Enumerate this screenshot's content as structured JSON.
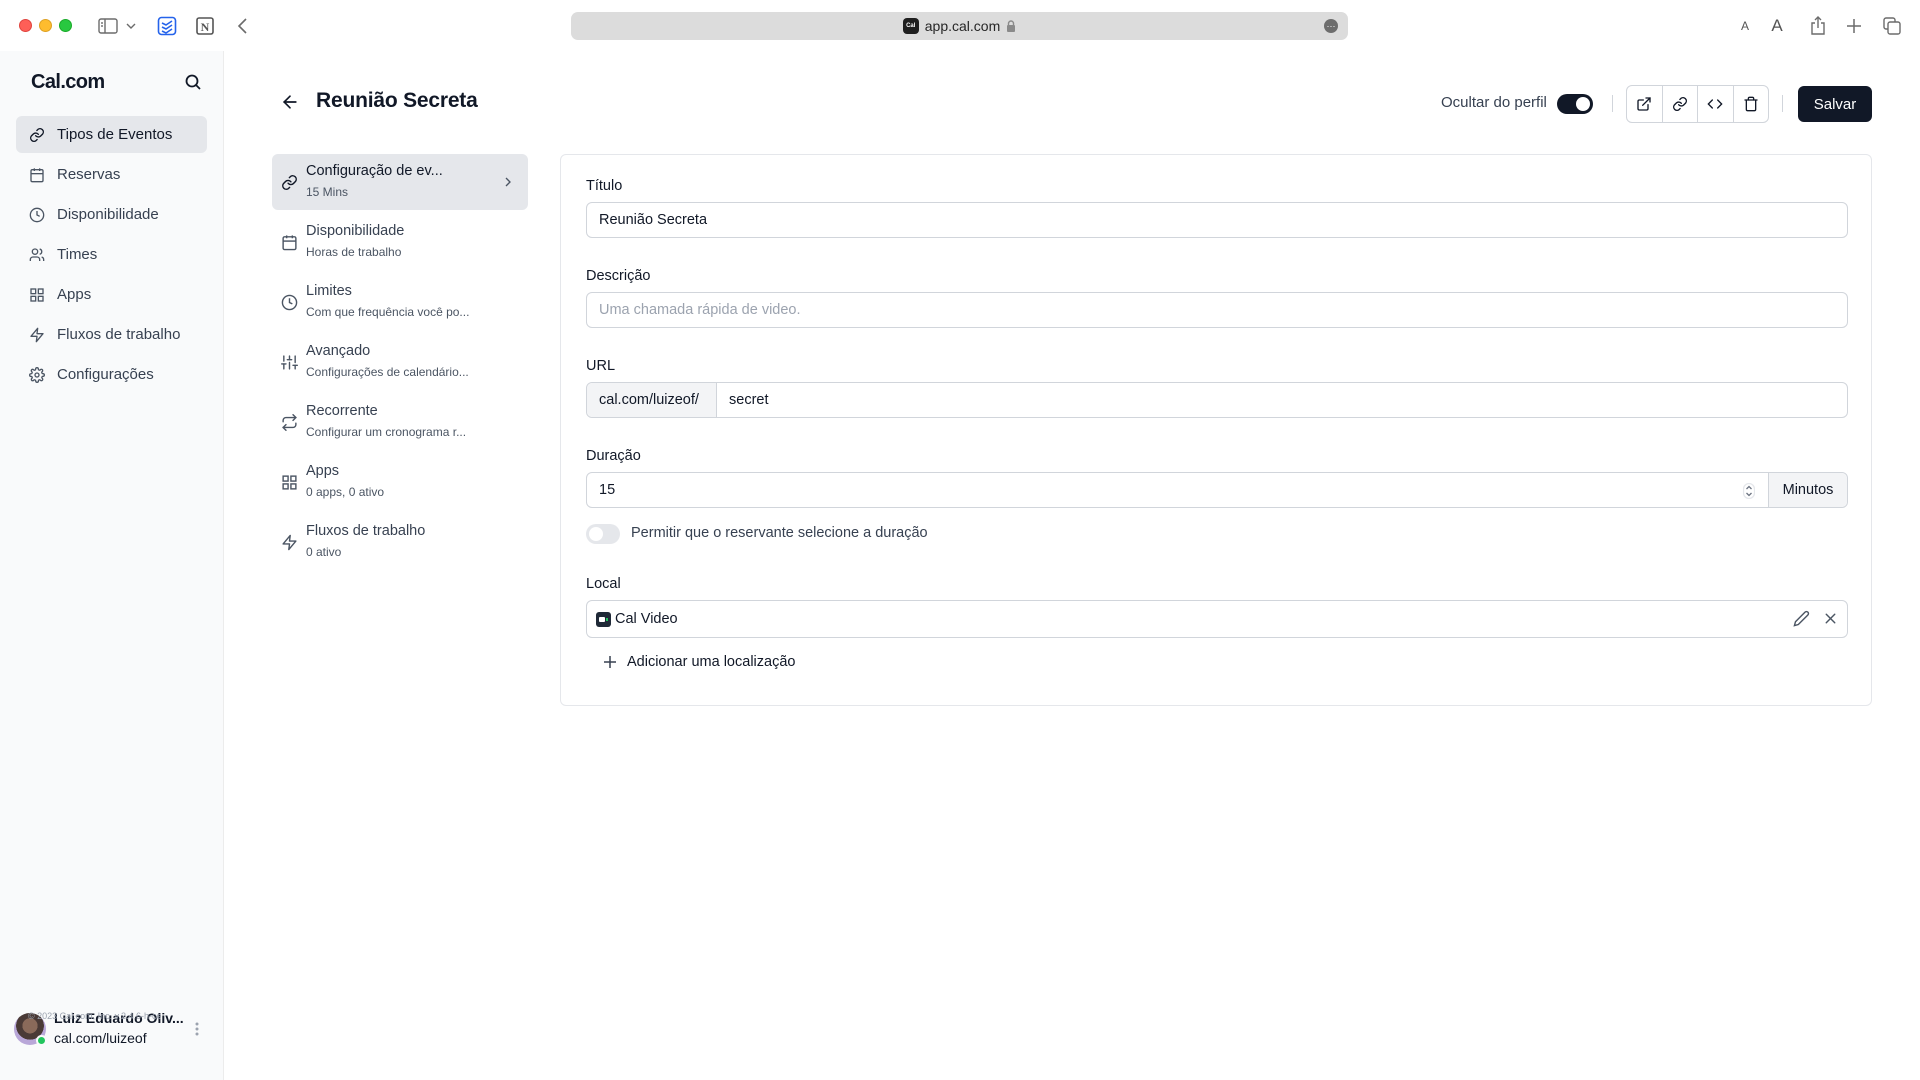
{
  "browser": {
    "url": "app.cal.com",
    "favicon_text": "Cal",
    "text_size_small": "A",
    "text_size_large": "A"
  },
  "sidebar": {
    "brand": "Cal.com",
    "items": [
      {
        "label": "Tipos de Eventos",
        "icon": "link-icon",
        "active": true
      },
      {
        "label": "Reservas",
        "icon": "calendar-icon",
        "active": false
      },
      {
        "label": "Disponibilidade",
        "icon": "clock-icon",
        "active": false
      },
      {
        "label": "Times",
        "icon": "users-icon",
        "active": false
      },
      {
        "label": "Apps",
        "icon": "grid-icon",
        "active": false
      },
      {
        "label": "Fluxos de trabalho",
        "icon": "zap-icon",
        "active": false
      },
      {
        "label": "Configurações",
        "icon": "gear-icon",
        "active": false
      }
    ],
    "user": {
      "name": "Luiz Eduardo Oliv...",
      "handle": "cal.com/luizeof",
      "status": "online"
    },
    "copyright": "© 2023 Cal.com, Inc. v.2.4.6-h-ce"
  },
  "header": {
    "title": "Reunião Secreta",
    "hide_from_profile_label": "Ocultar do perfil",
    "hide_from_profile_on": true,
    "save_label": "Salvar"
  },
  "tabs": [
    {
      "title": "Configuração de ev...",
      "subtitle": "15 Mins",
      "icon": "link-icon",
      "active": true
    },
    {
      "title": "Disponibilidade",
      "subtitle": "Horas de trabalho",
      "icon": "calendar-icon",
      "active": false
    },
    {
      "title": "Limites",
      "subtitle": "Com que frequência você po...",
      "icon": "clock-icon",
      "active": false
    },
    {
      "title": "Avançado",
      "subtitle": "Configurações de calendário...",
      "icon": "sliders-icon",
      "active": false
    },
    {
      "title": "Recorrente",
      "subtitle": "Configurar um cronograma r...",
      "icon": "repeat-icon",
      "active": false
    },
    {
      "title": "Apps",
      "subtitle": "0 apps, 0 ativo",
      "icon": "grid-icon",
      "active": false
    },
    {
      "title": "Fluxos de trabalho",
      "subtitle": "0 ativo",
      "icon": "zap-icon",
      "active": false
    }
  ],
  "form": {
    "title_label": "Título",
    "title_value": "Reunião Secreta",
    "description_label": "Descrição",
    "description_placeholder": "Uma chamada rápida de video.",
    "url_label": "URL",
    "url_prefix": "cal.com/luizeof/",
    "url_slug": "secret",
    "duration_label": "Duração",
    "duration_value": "15",
    "duration_unit": "Minutos",
    "allow_booker_duration_label": "Permitir que o reservante selecione a duração",
    "allow_booker_duration_on": false,
    "location_label": "Local",
    "location_value": "Cal Video",
    "add_location_label": "Adicionar uma localização"
  }
}
